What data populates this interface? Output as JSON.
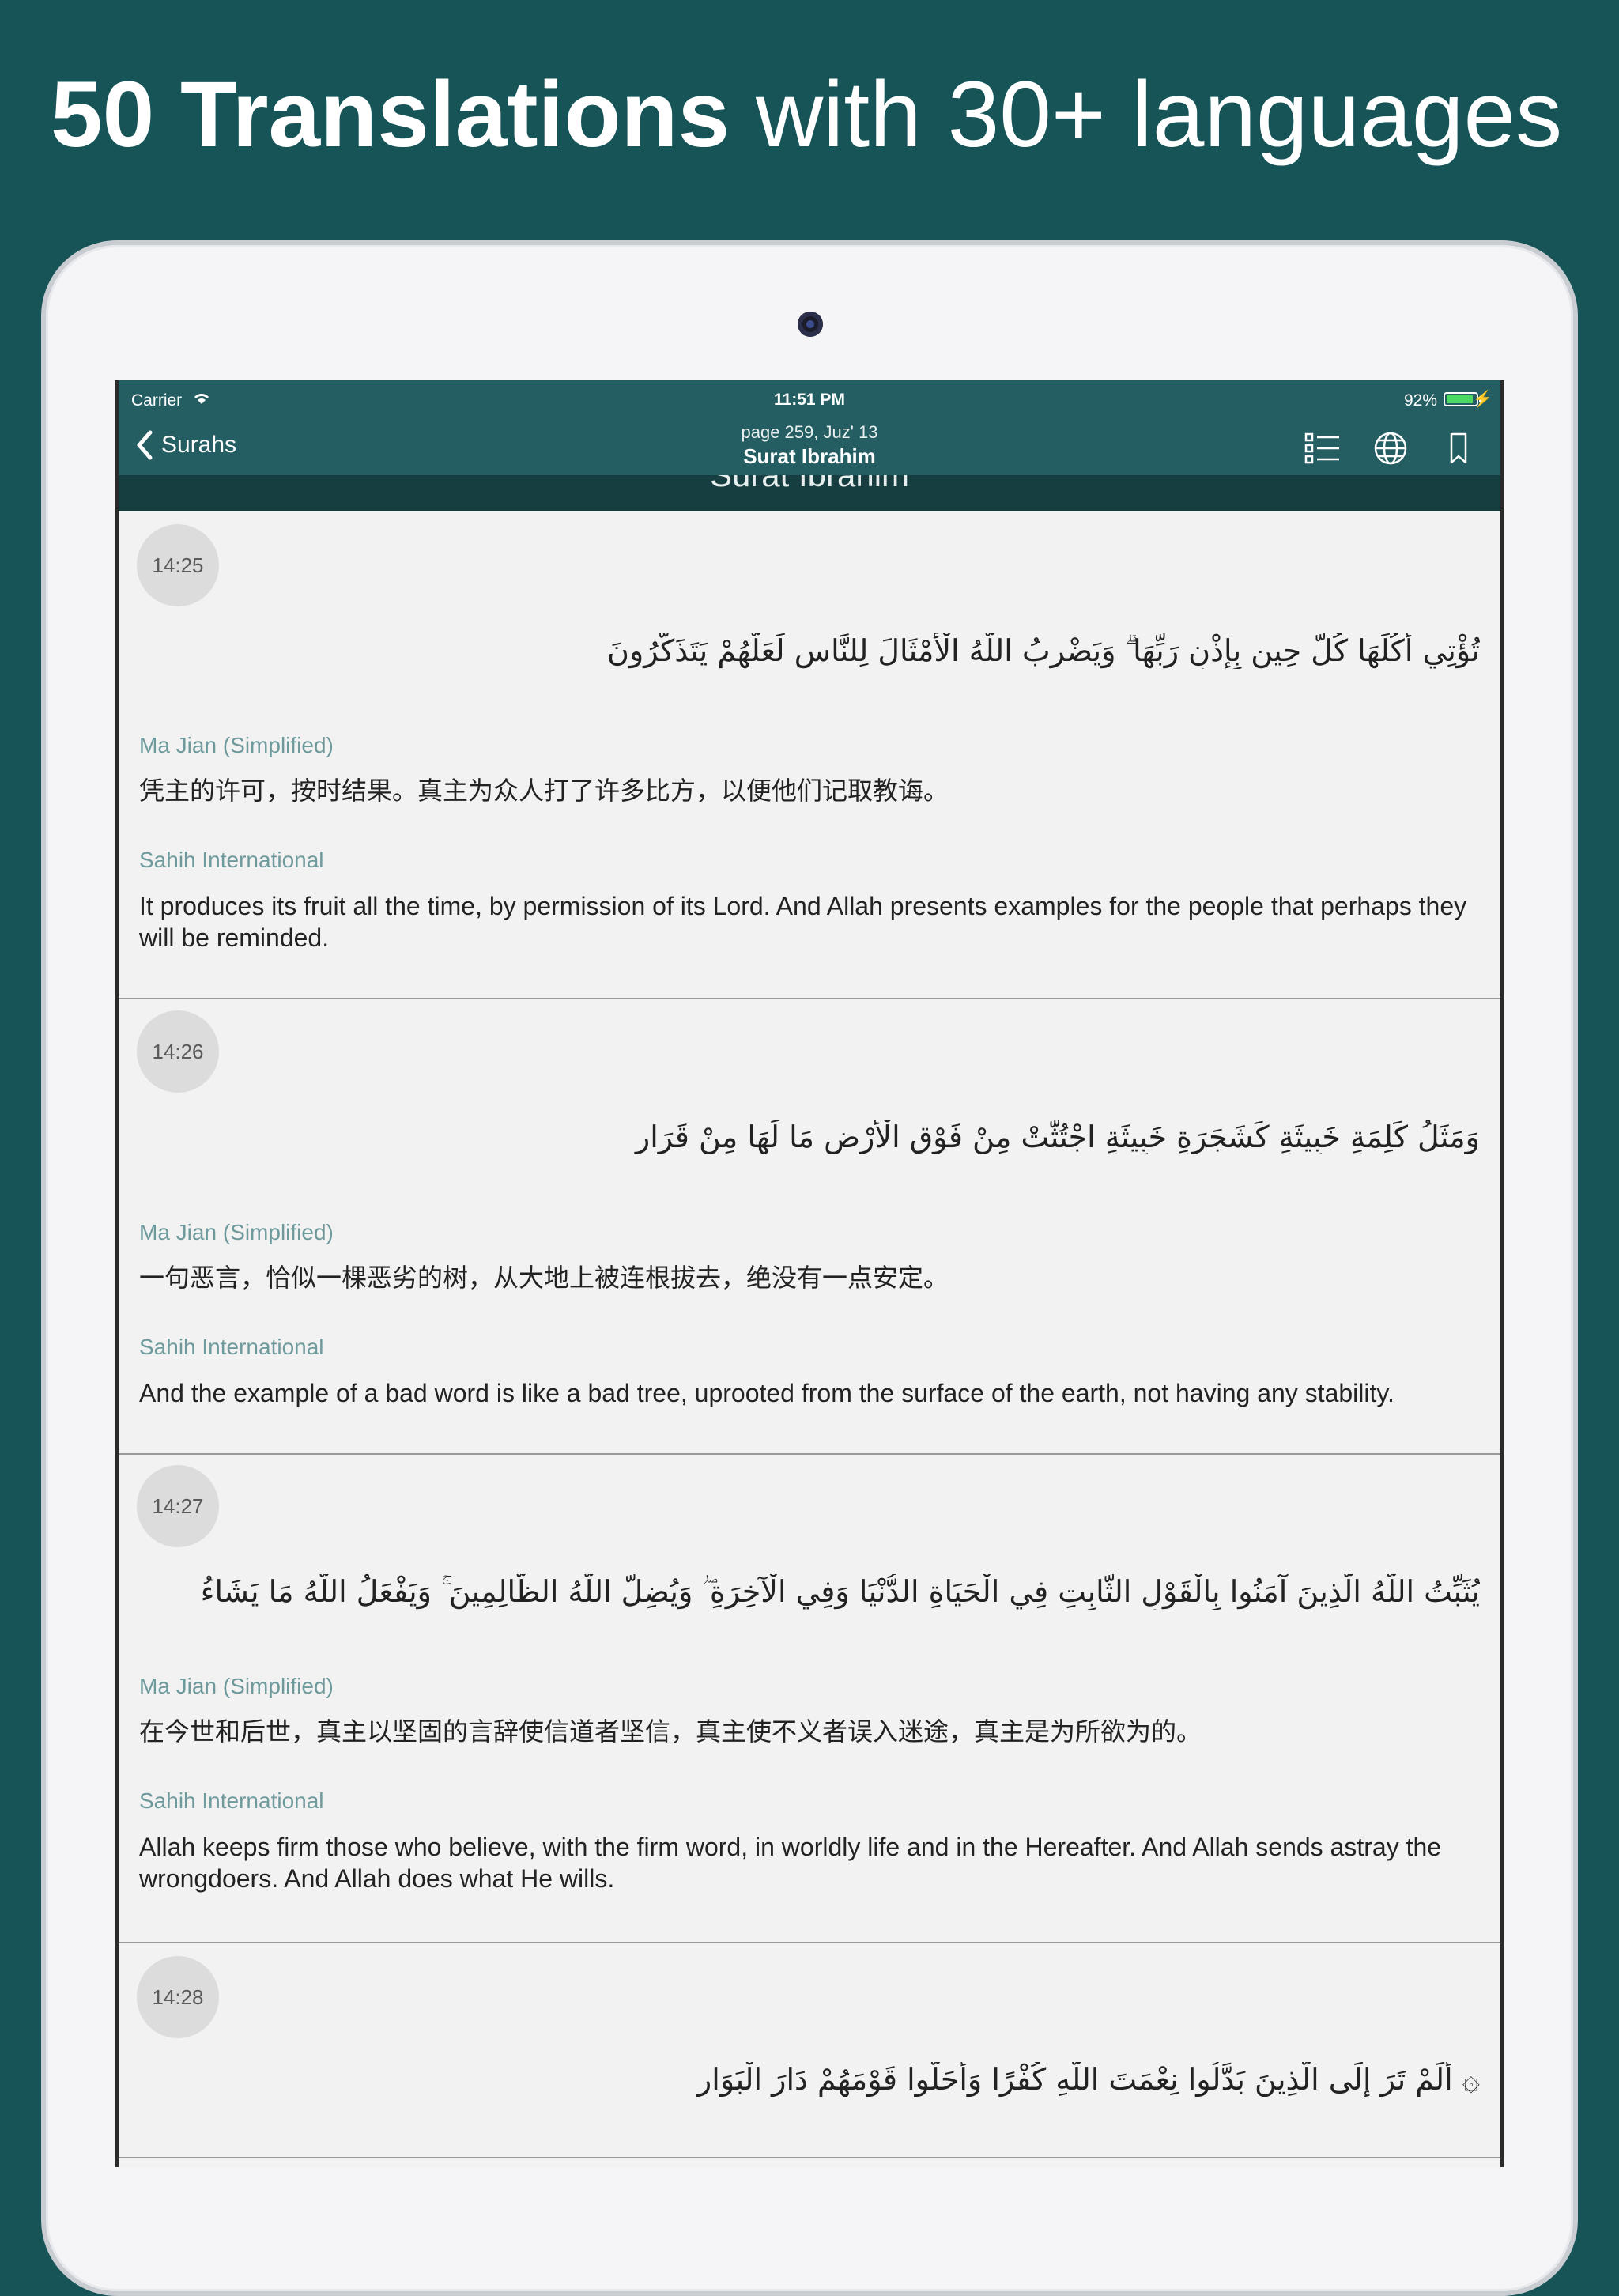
{
  "headline": {
    "bold": "50 Translations",
    "light": "with 30+ languages"
  },
  "status_bar": {
    "carrier": "Carrier",
    "time": "11:51 PM",
    "battery": "92%"
  },
  "nav": {
    "back_label": "Surahs",
    "subtitle": "page 259, Juz' 13",
    "title": "Surat Ibrahim",
    "icons": [
      "list-checklist-icon",
      "globe-icon",
      "bookmark-icon"
    ]
  },
  "section_header": "Surat Ibrahim",
  "colors": {
    "background": "#175458",
    "nav": "#245e62",
    "translator": "#6e9a9c"
  },
  "verses": [
    {
      "number": "14:25",
      "arabic": "تُؤْتِي أُكُلَهَا كُلَّ حِينٍ بِإِذْنِ رَبِّهَا ۗ وَيَضْرِبُ اللَّهُ الْأَمْثَالَ لِلنَّاسِ لَعَلَّهُمْ يَتَذَكَّرُونَ",
      "translations": [
        {
          "name": "Ma Jian (Simplified)",
          "text": "凭主的许可，按时结果。真主为众人打了许多比方，以便他们记取教诲。"
        },
        {
          "name": "Sahih International",
          "text": "It produces its fruit all the time, by permission of its Lord. And Allah presents examples for the people that perhaps they will be reminded."
        }
      ]
    },
    {
      "number": "14:26",
      "arabic": "وَمَثَلُ كَلِمَةٍ خَبِيثَةٍ كَشَجَرَةٍ خَبِيثَةٍ اجْتُثَّتْ مِنْ فَوْقِ الْأَرْضِ مَا لَهَا مِنْ قَرَارٍ",
      "translations": [
        {
          "name": "Ma Jian (Simplified)",
          "text": "一句恶言，恰似一棵恶劣的树，从大地上被连根拔去，绝没有一点安定。"
        },
        {
          "name": "Sahih International",
          "text": "And the example of a bad word is like a bad tree, uprooted from the surface of the earth, not having any stability."
        }
      ]
    },
    {
      "number": "14:27",
      "arabic": "يُثَبِّتُ اللَّهُ الَّذِينَ آمَنُوا بِالْقَوْلِ الثَّابِتِ فِي الْحَيَاةِ الدُّنْيَا وَفِي الْآخِرَةِ ۖ وَيُضِلُّ اللَّهُ الظَّالِمِينَ ۚ وَيَفْعَلُ اللَّهُ مَا يَشَاءُ",
      "translations": [
        {
          "name": "Ma Jian (Simplified)",
          "text": "在今世和后世，真主以坚固的言辞使信道者坚信，真主使不义者误入迷途，真主是为所欲为的。"
        },
        {
          "name": "Sahih International",
          "text": "Allah keeps firm those who believe, with the firm word, in worldly life and in the Hereafter. And Allah sends astray the wrongdoers. And Allah does what He wills."
        }
      ]
    },
    {
      "number": "14:28",
      "arabic": "۞ أَلَمْ تَرَ إِلَى الَّذِينَ بَدَّلُوا نِعْمَتَ اللَّهِ كُفْرًا وَأَحَلُّوا قَوْمَهُمْ دَارَ الْبَوَارِ",
      "translations": []
    }
  ]
}
